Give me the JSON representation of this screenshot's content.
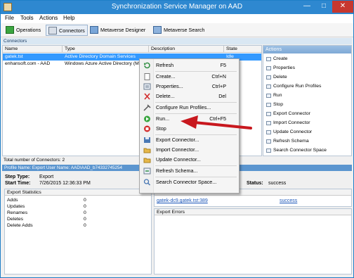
{
  "window": {
    "title": "Synchronization Service Manager on AAD",
    "minimize": "—",
    "maximize": "□",
    "close": "✕"
  },
  "menu": [
    "File",
    "Tools",
    "Actions",
    "Help"
  ],
  "toolbar": {
    "operations": "Operations",
    "connectors": "Connectors",
    "metaverse_designer": "Metaverse Designer",
    "metaverse_search": "Metaverse Search"
  },
  "connectors_section": "Connectors",
  "grid": {
    "columns": [
      "Name",
      "Type",
      "Description",
      "State"
    ],
    "rows": [
      {
        "name": "gatek.tst",
        "type": "Active Directory Domain Services",
        "description": "",
        "state": "Idle"
      },
      {
        "name": "enhansoft.com - AAD",
        "type": "Windows Azure Active Directory (Mi",
        "description": "",
        "state": ""
      }
    ]
  },
  "actions_panel": {
    "title": "Actions",
    "items": [
      "Create",
      "Properties",
      "Delete",
      "Configure Run Profiles",
      "Run",
      "Stop",
      "Export Connector",
      "Import Connector",
      "Update Connector",
      "Refresh Schema",
      "Search Connector Space"
    ]
  },
  "total_connectors": "Total number of Connectors: 2",
  "profile_bar": "Profile Name: Export  User Name: AAD\\AAD_b74332745254",
  "step_type_label": "Step Type:",
  "step_type_value": "Export",
  "start_time_label": "Start Time:",
  "start_time_value": "7/26/2015 12:36:33 PM",
  "status_label": "Status:",
  "status_value": "success",
  "export_stats": {
    "header": "Export Statistics",
    "rows": [
      {
        "label": "Adds",
        "value": "0"
      },
      {
        "label": "Updates",
        "value": "0"
      },
      {
        "label": "Renames",
        "value": "0"
      },
      {
        "label": "Deletes",
        "value": "0"
      },
      {
        "label": "Delete Adds",
        "value": "0"
      }
    ]
  },
  "connection_status": {
    "header": "Connection Status",
    "server": "gatek-dc9.gatek.tst:389",
    "result": "success"
  },
  "export_errors": {
    "header": "Export Errors"
  },
  "context_menu": {
    "items": [
      {
        "label": "Refresh",
        "shortcut": "F5",
        "icon": "refresh-icon"
      },
      {
        "label": "Create...",
        "shortcut": "Ctrl+N",
        "icon": "create-icon"
      },
      {
        "label": "Properties...",
        "shortcut": "Ctrl+P",
        "icon": "properties-icon"
      },
      {
        "label": "Delete...",
        "shortcut": "Del",
        "icon": "delete-icon"
      },
      {
        "label": "Configure Run Profiles...",
        "shortcut": "",
        "icon": "configure-icon"
      },
      {
        "label": "Run...",
        "shortcut": "Ctrl+F5",
        "icon": "run-icon"
      },
      {
        "label": "Stop",
        "shortcut": "",
        "icon": "stop-icon"
      },
      {
        "label": "Export Connector...",
        "shortcut": "",
        "icon": "export-icon"
      },
      {
        "label": "Import Connector...",
        "shortcut": "",
        "icon": "import-icon"
      },
      {
        "label": "Update Connector...",
        "shortcut": "",
        "icon": "update-icon"
      },
      {
        "label": "Refresh Schema...",
        "shortcut": "",
        "icon": "refresh-schema-icon"
      },
      {
        "label": "Search Connector Space...",
        "shortcut": "",
        "icon": "search-icon"
      }
    ]
  },
  "colors": {
    "titlebar": "#2e88d0",
    "selection": "#3399ff",
    "annotation_arrow": "#c8181e"
  }
}
